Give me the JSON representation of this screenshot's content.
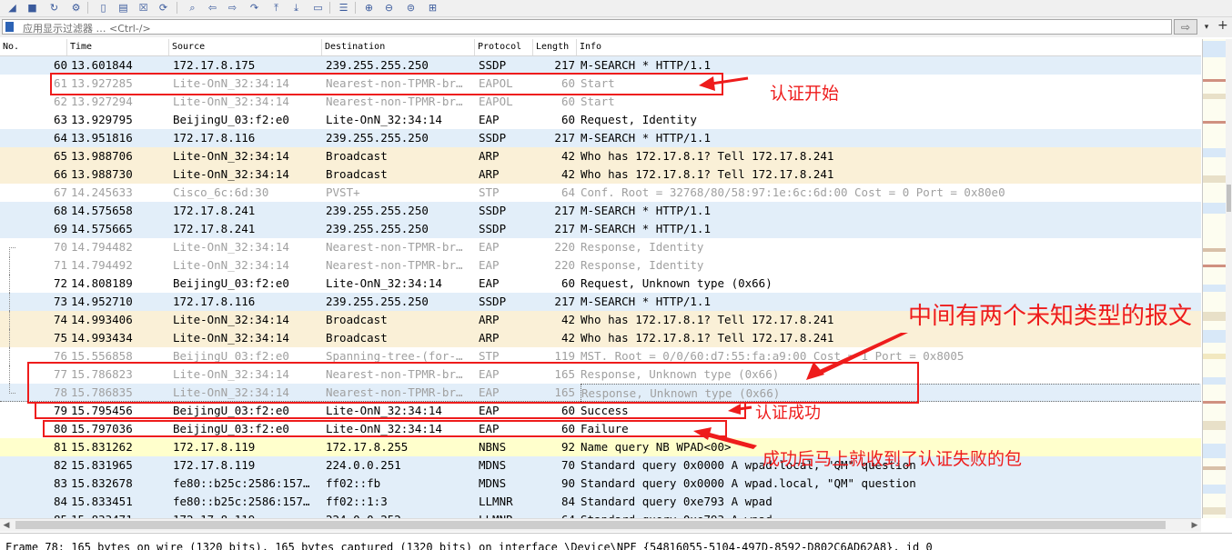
{
  "toolbar": {
    "icons": [
      "shark-fin-icon",
      "stop-icon",
      "restart-icon",
      "capture-options-icon",
      "open-file-icon",
      "save-file-icon",
      "close-file-icon",
      "reload-icon",
      "find-icon",
      "go-back-icon",
      "go-forward-icon",
      "go-to-packet-icon",
      "first-packet-icon",
      "last-packet-icon",
      "autoscroll-icon",
      "colorize-icon",
      "zoom-in-icon",
      "zoom-out-icon",
      "normal-size-icon",
      "resize-columns-icon"
    ]
  },
  "filter": {
    "placeholder": "应用显示过滤器 … <Ctrl-/>",
    "apply_glyph": "⇨",
    "dropdown_glyph": "▾",
    "add_glyph": "+"
  },
  "columns": [
    "No.",
    "Time",
    "Source",
    "Destination",
    "Protocol",
    "Length",
    "Info"
  ],
  "colors": {
    "blue_row": "#e2eef9",
    "tan_row": "#faf0d7",
    "white_row": "#ffffff",
    "yellow_row": "#ffffcc",
    "grey_text": "#a0a0a0",
    "annotation_red": "#ee1c1c"
  },
  "packets": [
    {
      "no": "60",
      "time": "13.601844",
      "src": "172.17.8.175",
      "dst": "239.255.255.250",
      "proto": "SSDP",
      "len": "217",
      "info": "M-SEARCH * HTTP/1.1",
      "bg": "blue",
      "dim": false
    },
    {
      "no": "61",
      "time": "13.927285",
      "src": "Lite-OnN_32:34:14",
      "dst": "Nearest-non-TPMR-br…",
      "proto": "EAPOL",
      "len": "60",
      "info": "Start",
      "bg": "white",
      "dim": true
    },
    {
      "no": "62",
      "time": "13.927294",
      "src": "Lite-OnN_32:34:14",
      "dst": "Nearest-non-TPMR-br…",
      "proto": "EAPOL",
      "len": "60",
      "info": "Start",
      "bg": "white",
      "dim": true
    },
    {
      "no": "63",
      "time": "13.929795",
      "src": "BeijingU_03:f2:e0",
      "dst": "Lite-OnN_32:34:14",
      "proto": "EAP",
      "len": "60",
      "info": "Request, Identity",
      "bg": "white",
      "dim": false
    },
    {
      "no": "64",
      "time": "13.951816",
      "src": "172.17.8.116",
      "dst": "239.255.255.250",
      "proto": "SSDP",
      "len": "217",
      "info": "M-SEARCH * HTTP/1.1",
      "bg": "blue",
      "dim": false
    },
    {
      "no": "65",
      "time": "13.988706",
      "src": "Lite-OnN_32:34:14",
      "dst": "Broadcast",
      "proto": "ARP",
      "len": "42",
      "info": "Who has 172.17.8.1? Tell 172.17.8.241",
      "bg": "tan",
      "dim": false
    },
    {
      "no": "66",
      "time": "13.988730",
      "src": "Lite-OnN_32:34:14",
      "dst": "Broadcast",
      "proto": "ARP",
      "len": "42",
      "info": "Who has 172.17.8.1? Tell 172.17.8.241",
      "bg": "tan",
      "dim": false
    },
    {
      "no": "67",
      "time": "14.245633",
      "src": "Cisco_6c:6d:30",
      "dst": "PVST+",
      "proto": "STP",
      "len": "64",
      "info": "Conf. Root = 32768/80/58:97:1e:6c:6d:00  Cost = 0  Port = 0x80e0",
      "bg": "white",
      "dim": true
    },
    {
      "no": "68",
      "time": "14.575658",
      "src": "172.17.8.241",
      "dst": "239.255.255.250",
      "proto": "SSDP",
      "len": "217",
      "info": "M-SEARCH * HTTP/1.1",
      "bg": "blue",
      "dim": false
    },
    {
      "no": "69",
      "time": "14.575665",
      "src": "172.17.8.241",
      "dst": "239.255.255.250",
      "proto": "SSDP",
      "len": "217",
      "info": "M-SEARCH * HTTP/1.1",
      "bg": "blue",
      "dim": false
    },
    {
      "no": "70",
      "time": "14.794482",
      "src": "Lite-OnN_32:34:14",
      "dst": "Nearest-non-TPMR-br…",
      "proto": "EAP",
      "len": "220",
      "info": "Response, Identity",
      "bg": "white",
      "dim": true
    },
    {
      "no": "71",
      "time": "14.794492",
      "src": "Lite-OnN_32:34:14",
      "dst": "Nearest-non-TPMR-br…",
      "proto": "EAP",
      "len": "220",
      "info": "Response, Identity",
      "bg": "white",
      "dim": true
    },
    {
      "no": "72",
      "time": "14.808189",
      "src": "BeijingU_03:f2:e0",
      "dst": "Lite-OnN_32:34:14",
      "proto": "EAP",
      "len": "60",
      "info": "Request, Unknown type (0x66)",
      "bg": "white",
      "dim": false
    },
    {
      "no": "73",
      "time": "14.952710",
      "src": "172.17.8.116",
      "dst": "239.255.255.250",
      "proto": "SSDP",
      "len": "217",
      "info": "M-SEARCH * HTTP/1.1",
      "bg": "blue",
      "dim": false
    },
    {
      "no": "74",
      "time": "14.993406",
      "src": "Lite-OnN_32:34:14",
      "dst": "Broadcast",
      "proto": "ARP",
      "len": "42",
      "info": "Who has 172.17.8.1? Tell 172.17.8.241",
      "bg": "tan",
      "dim": false
    },
    {
      "no": "75",
      "time": "14.993434",
      "src": "Lite-OnN_32:34:14",
      "dst": "Broadcast",
      "proto": "ARP",
      "len": "42",
      "info": "Who has 172.17.8.1? Tell 172.17.8.241",
      "bg": "tan",
      "dim": false
    },
    {
      "no": "76",
      "time": "15.556858",
      "src": "BeijingU_03:f2:e0",
      "dst": "Spanning-tree-(for-…",
      "proto": "STP",
      "len": "119",
      "info": "MST. Root = 0/0/60:d7:55:fa:a9:00  Cost = 1  Port = 0x8005",
      "bg": "white",
      "dim": true
    },
    {
      "no": "77",
      "time": "15.786823",
      "src": "Lite-OnN_32:34:14",
      "dst": "Nearest-non-TPMR-br…",
      "proto": "EAP",
      "len": "165",
      "info": "Response, Unknown type (0x66)",
      "bg": "white",
      "dim": true
    },
    {
      "no": "78",
      "time": "15.786835",
      "src": "Lite-OnN_32:34:14",
      "dst": "Nearest-non-TPMR-br…",
      "proto": "EAP",
      "len": "165",
      "info": "Response, Unknown type (0x66)",
      "bg": "selected",
      "dim": true
    },
    {
      "no": "79",
      "time": "15.795456",
      "src": "BeijingU_03:f2:e0",
      "dst": "Lite-OnN_32:34:14",
      "proto": "EAP",
      "len": "60",
      "info": "Success",
      "bg": "white",
      "dim": false
    },
    {
      "no": "80",
      "time": "15.797036",
      "src": "BeijingU_03:f2:e0",
      "dst": "Lite-OnN_32:34:14",
      "proto": "EAP",
      "len": "60",
      "info": "Failure",
      "bg": "white",
      "dim": false
    },
    {
      "no": "81",
      "time": "15.831262",
      "src": "172.17.8.119",
      "dst": "172.17.8.255",
      "proto": "NBNS",
      "len": "92",
      "info": "Name query NB WPAD<00>",
      "bg": "yellow",
      "dim": false
    },
    {
      "no": "82",
      "time": "15.831965",
      "src": "172.17.8.119",
      "dst": "224.0.0.251",
      "proto": "MDNS",
      "len": "70",
      "info": "Standard query 0x0000 A wpad.local, \"QM\" question",
      "bg": "blue",
      "dim": false
    },
    {
      "no": "83",
      "time": "15.832678",
      "src": "fe80::b25c:2586:157…",
      "dst": "ff02::fb",
      "proto": "MDNS",
      "len": "90",
      "info": "Standard query 0x0000 A wpad.local, \"QM\" question",
      "bg": "blue",
      "dim": false
    },
    {
      "no": "84",
      "time": "15.833451",
      "src": "fe80::b25c:2586:157…",
      "dst": "ff02::1:3",
      "proto": "LLMNR",
      "len": "84",
      "info": "Standard query 0xe793 A wpad",
      "bg": "blue",
      "dim": false
    },
    {
      "no": "85",
      "time": "15.833471",
      "src": "172.17.8.119",
      "dst": "224.0.0.252",
      "proto": "LLMNR",
      "len": "64",
      "info": "Standard query 0xe793 A wpad",
      "bg": "blue",
      "dim": false
    }
  ],
  "annotations": {
    "start": "认证开始",
    "unknown": "中间有两个未知类型的报文",
    "success": "认证成功",
    "failure": "成功后马上就收到了认证失败的包"
  },
  "detail": {
    "text": "Frame 78: 165 bytes on wire (1320 bits), 165 bytes captured (1320 bits) on interface \\Device\\NPF_{54816055-5104-497D-8592-D802C6AD62A8}, id 0"
  }
}
